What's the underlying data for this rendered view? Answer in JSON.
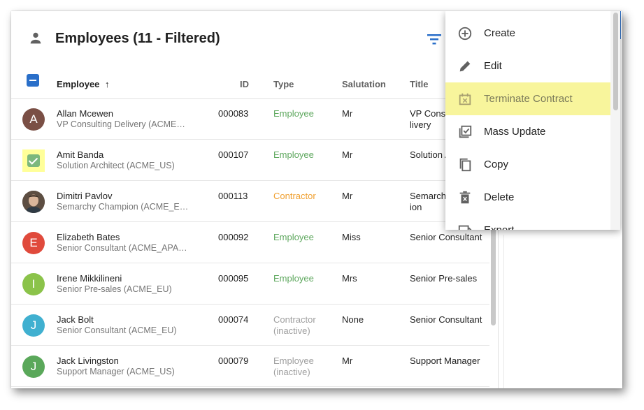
{
  "header": {
    "title": "Employees (11 - Filtered)",
    "icons": {
      "title": "person-icon",
      "filter": "filter-icon"
    }
  },
  "table": {
    "columns": [
      "Employee",
      "ID",
      "Type",
      "Salutation",
      "Title"
    ],
    "sort_indicator": "↑",
    "rows": [
      {
        "name": "Allan Mcewen",
        "sub": "VP Consulting Delivery (ACME…",
        "id": "000083",
        "type": "Employee",
        "type_kind": "employee",
        "salutation": "Mr",
        "title": "VP Consu\nlivery",
        "avatar": "A",
        "avatar_color": "#7a4f45"
      },
      {
        "name": "Amit Banda",
        "sub": "Solution Architect (ACME_US)",
        "id": "000107",
        "type": "Employee",
        "type_kind": "employee",
        "salutation": "Mr",
        "title": "Solution A",
        "avatar": "",
        "avatar_color": "#7cb87d",
        "selected": true
      },
      {
        "name": "Dimitri Pavlov",
        "sub": "Semarchy Champion (ACME_E…",
        "id": "000113",
        "type": "Contractor",
        "type_kind": "contractor",
        "salutation": "Mr",
        "title": "Semarch\nion",
        "avatar": "",
        "avatar_color": "#6b5a4b",
        "photo": true
      },
      {
        "name": "Elizabeth Bates",
        "sub": "Senior Consultant (ACME_APA…",
        "id": "000092",
        "type": "Employee",
        "type_kind": "employee",
        "salutation": "Miss",
        "title": "Senior Consultant",
        "avatar": "E",
        "avatar_color": "#e04a3c"
      },
      {
        "name": "Irene Mikkilineni",
        "sub": "Senior Pre-sales (ACME_EU)",
        "id": "000095",
        "type": "Employee",
        "type_kind": "employee",
        "salutation": "Mrs",
        "title": "Senior Pre-sales",
        "avatar": "I",
        "avatar_color": "#8bc34a"
      },
      {
        "name": "Jack Bolt",
        "sub": "Senior Consultant (ACME_EU)",
        "id": "000074",
        "type": "Contractor\n(inactive)",
        "type_kind": "inactive",
        "salutation": "None",
        "title": "Senior Consultant",
        "avatar": "J",
        "avatar_color": "#40b0d0"
      },
      {
        "name": "Jack Livingston",
        "sub": "Support Manager (ACME_US)",
        "id": "000079",
        "type": "Employee\n(inactive)",
        "type_kind": "inactive",
        "salutation": "Mr",
        "title": "Support Manager",
        "avatar": "J",
        "avatar_color": "#5aa85a"
      }
    ]
  },
  "menu": {
    "items": [
      {
        "label": "Create",
        "icon": "add-circle-icon"
      },
      {
        "label": "Edit",
        "icon": "pencil-icon"
      },
      {
        "label": "Terminate Contract",
        "icon": "calendar-x-icon",
        "highlight": true
      },
      {
        "label": "Mass Update",
        "icon": "checklist-icon"
      },
      {
        "label": "Copy",
        "icon": "copy-icon"
      },
      {
        "label": "Delete",
        "icon": "trash-icon"
      },
      {
        "label": "Export",
        "icon": "export-icon"
      }
    ]
  },
  "colors": {
    "accent": "#2a6fc9",
    "employee": "#5fa85f",
    "contractor": "#f0a030",
    "inactive": "#9e9e9e",
    "highlight": "#f8f59c"
  }
}
